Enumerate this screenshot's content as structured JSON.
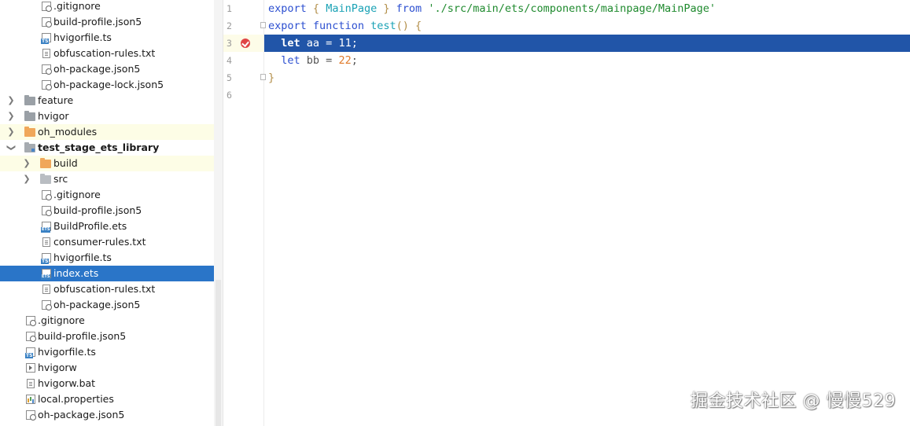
{
  "tree": {
    "items": [
      {
        "label": ".gitignore",
        "icon": "gitignore-file-icon"
      },
      {
        "label": "build-profile.json5",
        "icon": "config-file-icon"
      },
      {
        "label": "hvigorfile.ts",
        "icon": "typescript-file-icon"
      },
      {
        "label": "obfuscation-rules.txt",
        "icon": "text-file-icon"
      },
      {
        "label": "oh-package.json5",
        "icon": "config-file-icon"
      },
      {
        "label": "oh-package-lock.json5",
        "icon": "config-file-icon"
      },
      {
        "label": "feature",
        "icon": "folder-icon"
      },
      {
        "label": "hvigor",
        "icon": "folder-icon"
      },
      {
        "label": "oh_modules",
        "icon": "folder-orange-icon"
      },
      {
        "label": "test_stage_ets_library",
        "icon": "module-folder-icon"
      },
      {
        "label": "build",
        "icon": "folder-orange-icon"
      },
      {
        "label": "src",
        "icon": "source-folder-icon"
      },
      {
        "label": ".gitignore",
        "icon": "gitignore-file-icon"
      },
      {
        "label": "build-profile.json5",
        "icon": "config-file-icon"
      },
      {
        "label": "BuildProfile.ets",
        "icon": "ets-file-icon"
      },
      {
        "label": "consumer-rules.txt",
        "icon": "text-file-icon"
      },
      {
        "label": "hvigorfile.ts",
        "icon": "typescript-file-icon"
      },
      {
        "label": "index.ets",
        "icon": "ets-file-icon"
      },
      {
        "label": "obfuscation-rules.txt",
        "icon": "text-file-icon"
      },
      {
        "label": "oh-package.json5",
        "icon": "config-file-icon"
      },
      {
        "label": ".gitignore",
        "icon": "gitignore-file-icon"
      },
      {
        "label": "build-profile.json5",
        "icon": "config-file-icon"
      },
      {
        "label": "hvigorfile.ts",
        "icon": "typescript-file-icon"
      },
      {
        "label": "hvigorw",
        "icon": "executable-file-icon"
      },
      {
        "label": "hvigorw.bat",
        "icon": "text-file-icon"
      },
      {
        "label": "local.properties",
        "icon": "properties-file-icon"
      },
      {
        "label": "oh-package.json5",
        "icon": "config-file-icon"
      }
    ],
    "selected": "index.ets"
  },
  "editor": {
    "line_numbers": [
      "1",
      "2",
      "3",
      "4",
      "5",
      "6"
    ],
    "lines": [
      {
        "tokens": [
          [
            "kw",
            "export"
          ],
          [
            "plain",
            " "
          ],
          [
            "brace",
            "{"
          ],
          [
            "plain",
            " "
          ],
          [
            "fn",
            "MainPage"
          ],
          [
            "plain",
            " "
          ],
          [
            "brace",
            "}"
          ],
          [
            "plain",
            " "
          ],
          [
            "kw",
            "from"
          ],
          [
            "plain",
            " "
          ],
          [
            "str",
            "'./src/main/ets/components/mainpage/MainPage'"
          ]
        ]
      },
      {
        "tokens": [
          [
            "kw",
            "export"
          ],
          [
            "plain",
            " "
          ],
          [
            "kw",
            "function"
          ],
          [
            "plain",
            " "
          ],
          [
            "fn",
            "test"
          ],
          [
            "brace",
            "()"
          ],
          [
            "plain",
            " "
          ],
          [
            "brace",
            "{"
          ]
        ]
      },
      {
        "tokens": [
          [
            "plain",
            "  "
          ],
          [
            "kw",
            "let"
          ],
          [
            "plain",
            " aa = "
          ],
          [
            "num2",
            "11"
          ],
          [
            "plain",
            ";"
          ]
        ]
      },
      {
        "tokens": [
          [
            "plain",
            "  "
          ],
          [
            "kw",
            "let"
          ],
          [
            "plain",
            " bb = "
          ],
          [
            "num2",
            "22"
          ],
          [
            "plain",
            ";"
          ]
        ]
      },
      {
        "tokens": [
          [
            "brace",
            "}"
          ]
        ]
      },
      {
        "tokens": []
      }
    ],
    "highlighted_line": "3",
    "breakpoint_line": "3"
  },
  "watermark": "掘金技术社区 @ 慢慢529",
  "colors": {
    "selection": "#2a75c8",
    "line_highlight": "#2155a8",
    "keyword": "#2c4fd0",
    "string": "#1f8a2e",
    "number": "#e07a2a",
    "breakpoint": "#e04545"
  }
}
